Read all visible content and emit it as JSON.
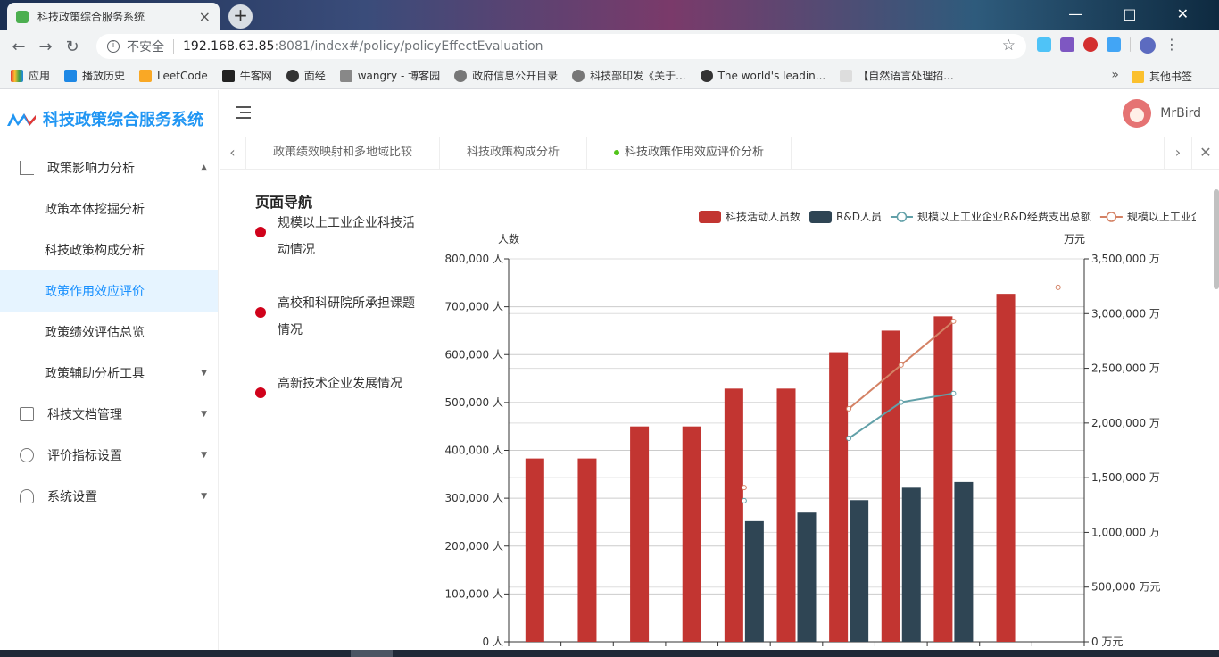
{
  "browser": {
    "tab_title": "科技政策综合服务系统",
    "security_label": "不安全",
    "url_host": "192.168.63.85",
    "url_path": ":8081/index#/policy/policyEffectEvaluation",
    "bookmarks": [
      "应用",
      "播放历史",
      "LeetCode",
      "牛客网",
      "面经",
      "wangry - 博客园",
      "政府信息公开目录",
      "科技部印发《关于...",
      "The world's leadin...",
      "【自然语言处理招..."
    ],
    "other_bookmarks": "其他书签"
  },
  "app": {
    "title": "科技政策综合服务系统",
    "user": "MrBird"
  },
  "sidebar": {
    "items": [
      {
        "label": "政策影响力分析",
        "icon": "chart-icon",
        "expanded": true
      },
      {
        "label": "政策本体挖掘分析",
        "sub": true
      },
      {
        "label": "科技政策构成分析",
        "sub": true
      },
      {
        "label": "政策作用效应评价",
        "sub": true,
        "active": true
      },
      {
        "label": "政策绩效评估总览",
        "sub": true
      },
      {
        "label": "政策辅助分析工具",
        "sub": true,
        "expandable": true
      },
      {
        "label": "科技文档管理",
        "icon": "document-icon"
      },
      {
        "label": "评价指标设置",
        "icon": "gear-icon"
      },
      {
        "label": "系统设置",
        "icon": "user-icon"
      }
    ]
  },
  "tabs": [
    "政策绩效映射和多地域比较",
    "科技政策构成分析",
    "科技政策作用效应评价分析"
  ],
  "page_nav": {
    "title": "页面导航",
    "items": [
      "规模以上工业企业科技活动情况",
      "高校和科研院所承担课题情况",
      "高新技术企业发展情况"
    ]
  },
  "colors": {
    "accent": "#1890ff",
    "series1": "#c23531",
    "series2": "#2f4554",
    "series3": "#61a0a8",
    "series4": "#d48265"
  },
  "chart_data": {
    "type": "bar",
    "legend": [
      "科技活动人员数",
      "R&D人员",
      "规模以上工业企业R&D经费支出总额",
      "规模以上工业企业新产品开发经费支出"
    ],
    "left_axis": {
      "name": "人数",
      "ylim": [
        0,
        800000
      ],
      "ticks": [
        "0 人",
        "100,000 人",
        "200,000 人",
        "300,000 人",
        "400,000 人",
        "500,000 人",
        "600,000 人",
        "700,000 人",
        "800,000 人"
      ]
    },
    "right_axis": {
      "name": "万元",
      "ylim": [
        0,
        3500000
      ],
      "ticks": [
        "0 万元",
        "500,000 万元",
        "1,000,000 万",
        "1,500,000 万",
        "2,000,000 万",
        "2,500,000 万",
        "3,000,000 万",
        "3,500,000 万"
      ]
    },
    "categories": 11,
    "series": [
      {
        "name": "科技活动人员数",
        "kind": "bar",
        "axis": "left",
        "values": [
          383000,
          383000,
          450000,
          450000,
          529000,
          529000,
          605000,
          650000,
          680000,
          727000,
          null
        ]
      },
      {
        "name": "R&D人员",
        "kind": "bar",
        "axis": "left",
        "values": [
          null,
          null,
          null,
          null,
          252000,
          270000,
          296000,
          322000,
          334000,
          null,
          null
        ]
      },
      {
        "name": "规模以上工业企业R&D经费支出总额",
        "kind": "line",
        "axis": "right",
        "values": [
          null,
          null,
          null,
          null,
          1290000,
          null,
          1860000,
          2190000,
          2270000,
          null,
          null
        ]
      },
      {
        "name": "规模以上工业企业新产品开发经费支出",
        "kind": "line",
        "axis": "right",
        "values": [
          null,
          null,
          null,
          null,
          1410000,
          null,
          2130000,
          2530000,
          2930000,
          null,
          3240000
        ]
      }
    ]
  }
}
